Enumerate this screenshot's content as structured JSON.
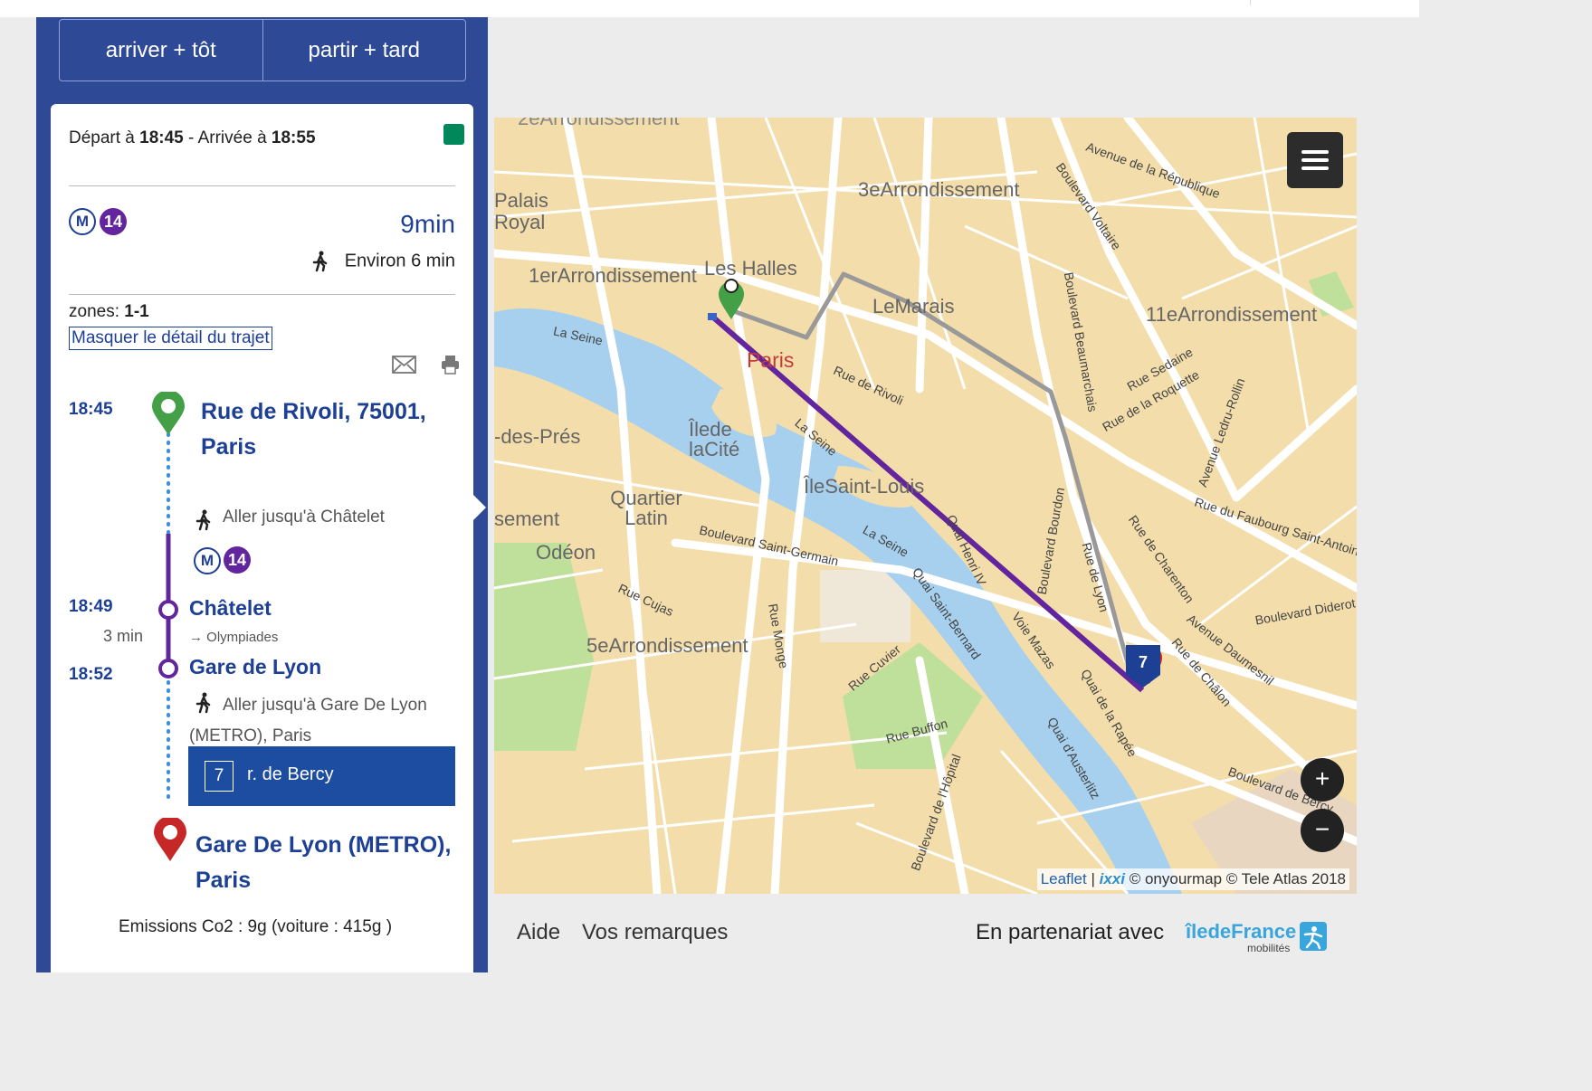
{
  "nav": {
    "earlier": "arriver + tôt",
    "later": "partir + tard"
  },
  "trip": {
    "depart_prefix": "Départ à",
    "depart_time": "18:45",
    "arrive_prefix": "- Arrivée à",
    "arrive_time": "18:55",
    "metro_symbol": "M",
    "line": "14",
    "duration": "9min",
    "walk_summary": "Environ 6 min",
    "zones_label": "zones:",
    "zones_value": "1-1",
    "toggle_detail": "Masquer le détail du trajet"
  },
  "steps": {
    "start_time": "18:45",
    "start_address": "Rue de Rivoli, 75001, Paris",
    "walk_to_first": "Aller jusqu'à Châtelet",
    "chatelet_time": "18:49",
    "chatelet": "Châtelet",
    "direction": "→ Olympiades",
    "ride_duration": "3 min",
    "gare_time": "18:52",
    "gare": "Gare de Lyon",
    "walk_to_dest": "Aller jusqu'à Gare De Lyon (METRO), Paris",
    "bus_number": "7",
    "bus_label": "r. de Bercy",
    "destination": "Gare De Lyon (METRO), Paris"
  },
  "emissions": "Emissions Co2 : 9g (voiture : 415g )",
  "map": {
    "labels": {
      "palais": "Palais Royal",
      "arr1": "1erArrondissement",
      "halles": "Les Halles",
      "arr3": "3eArrondissement",
      "marais": "LeMarais",
      "arr11": "11eArrondissement",
      "paris": "Paris",
      "cite": "Îlede laCité",
      "stlouis": "ÎleSaint-Louis",
      "quartier": "Quartier Latin",
      "odeon": "Odéon",
      "arr5": "5eArrondissement",
      "depres": "-des-Prés",
      "sement": "sement",
      "arr2_top": "2eArrondissement"
    },
    "streets": {
      "republique": "Avenue de la République",
      "voltaire": "Boulevard Voltaire",
      "rivoli": "Rue de Rivoli",
      "seine1": "La Seine",
      "seine2": "La Seine",
      "seine3": "La Seine",
      "stgermain": "Boulevard Saint-Germain",
      "henri4": "Quai Henri IV",
      "stbernard": "Quai Saint-Bernard",
      "mazas": "Voie Mazas",
      "rapee": "Quai de la Rapée",
      "austerlitz": "Quai d'Austerlitz",
      "faubourg": "Rue du Faubourg Saint-Antoine",
      "daumesnil": "Avenue Daumesnil",
      "charenton": "Rue de Charenton",
      "chalon": "Rue de Châlon",
      "lyon": "Rue de Lyon",
      "buffon": "Rue Buffon",
      "cuvier": "Rue Cuvier",
      "cujas": "Rue Cujas",
      "monge": "Rue Monge",
      "hopital": "Boulevard de l'Hôpital",
      "bercy": "Boulevard de Bercy",
      "diderot": "Boulevard Diderot",
      "roquette": "Rue de la Roquette",
      "sedaine": "Rue Sedaine",
      "bourdon": "Boulevard Bourdon",
      "beaumarchais": "Boulevard Beaumarchais",
      "ledru": "Avenue Ledru-Rollin"
    },
    "bus_marker": "7",
    "zoom_in": "+",
    "zoom_out": "−",
    "attrib_leaflet": "Leaflet",
    "attrib_sep": "|",
    "attrib_ixxi": "ixxi",
    "attrib_rest": "© onyourmap © Tele Atlas 2018"
  },
  "footer": {
    "help": "Aide",
    "feedback": "Vos remarques",
    "partner": "En partenariat avec",
    "idf": "îledeFrance",
    "idf_sub": "mobilités"
  },
  "colors": {
    "primary": "#2e4a97",
    "metro14": "#62259d",
    "accent_green": "#00875a",
    "route_walk": "#909090",
    "start_pin": "#43a047",
    "end_pin": "#c62828"
  },
  "icons": [
    "walk-icon",
    "mail-icon",
    "print-icon",
    "menu-icon",
    "pin-start-icon",
    "pin-end-icon",
    "bus-stop-icon"
  ]
}
